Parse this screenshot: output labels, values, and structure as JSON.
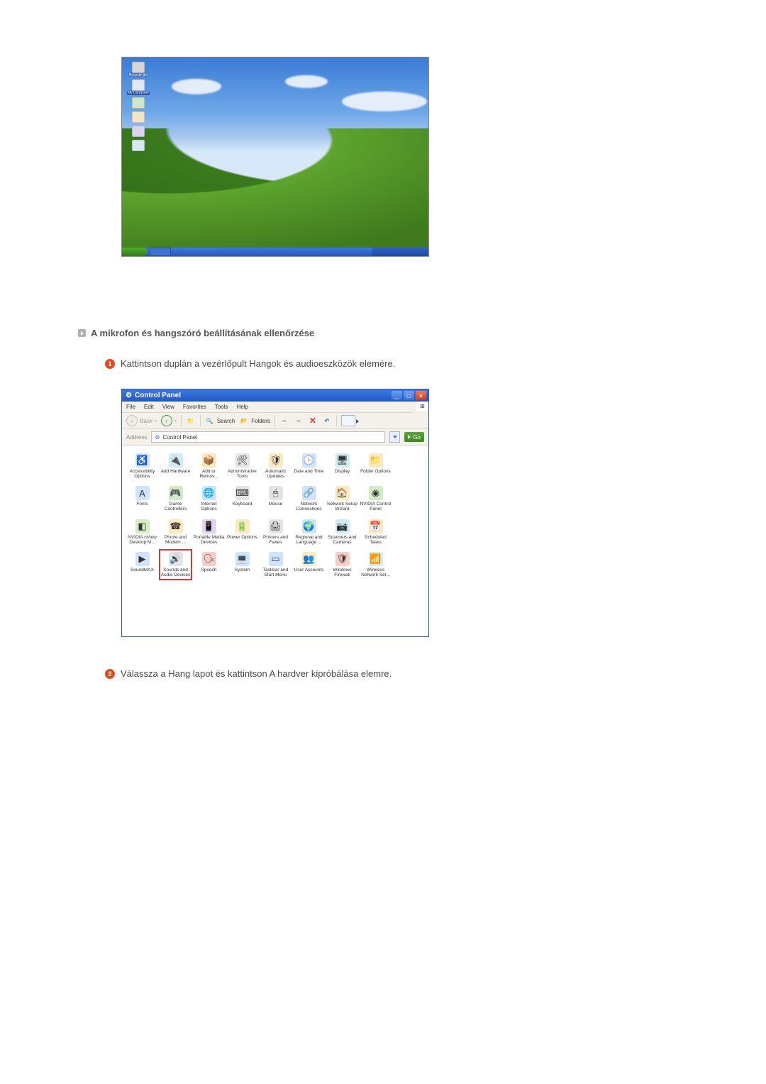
{
  "desktop": {
    "icons": [
      {
        "label": "Recycle Bin"
      },
      {
        "label": "My Computer"
      },
      {
        "label": ""
      },
      {
        "label": ""
      },
      {
        "label": ""
      },
      {
        "label": ""
      }
    ],
    "selected_icon_label": "My Computer"
  },
  "section": {
    "heading": "A mikrofon és hangszóró beállításának ellenőrzése",
    "step1": "Kattintson duplán a vezérlőpult Hangok és audioeszközök elemére.",
    "step2": "Válassza a Hang lapot és kattintson A hardver kipróbálása elemre."
  },
  "control_panel": {
    "title": "Control Panel",
    "menu": {
      "file": "File",
      "edit": "Edit",
      "view": "View",
      "favorites": "Favorites",
      "tools": "Tools",
      "help": "Help"
    },
    "toolbar": {
      "back": "Back",
      "search": "Search",
      "folders": "Folders"
    },
    "address": {
      "label": "Address",
      "value": "Control Panel",
      "go": "Go"
    },
    "items": [
      {
        "label": "Accessibility Options",
        "iconClass": "bg-blue",
        "glyph": "♿"
      },
      {
        "label": "Add Hardware",
        "iconClass": "bg-cyn",
        "glyph": "🔌"
      },
      {
        "label": "Add or Remov...",
        "iconClass": "bg-yel",
        "glyph": "📦"
      },
      {
        "label": "Administrative Tools",
        "iconClass": "bg-gry",
        "glyph": "🛠"
      },
      {
        "label": "Automatic Updates",
        "iconClass": "bg-yel",
        "glyph": "🛡"
      },
      {
        "label": "Date and Time",
        "iconClass": "bg-blue",
        "glyph": "🕒"
      },
      {
        "label": "Display",
        "iconClass": "bg-cyn",
        "glyph": "🖥"
      },
      {
        "label": "Folder Options",
        "iconClass": "bg-yel",
        "glyph": "📁"
      },
      {
        "label": "Fonts",
        "iconClass": "bg-blue",
        "glyph": "A"
      },
      {
        "label": "Game Controllers",
        "iconClass": "bg-grn",
        "glyph": "🎮"
      },
      {
        "label": "Internet Options",
        "iconClass": "bg-blue",
        "glyph": "🌐"
      },
      {
        "label": "Keyboard",
        "iconClass": "bg-gry",
        "glyph": "⌨"
      },
      {
        "label": "Mouse",
        "iconClass": "bg-gry",
        "glyph": "🖱"
      },
      {
        "label": "Network Connections",
        "iconClass": "bg-blue",
        "glyph": "🔗"
      },
      {
        "label": "Network Setup Wizard",
        "iconClass": "bg-yel",
        "glyph": "🏠"
      },
      {
        "label": "NVIDIA Control Panel",
        "iconClass": "bg-grn",
        "glyph": "◉"
      },
      {
        "label": "NVIDIA nView Desktop M...",
        "iconClass": "bg-grn",
        "glyph": "◧"
      },
      {
        "label": "Phone and Modem ...",
        "iconClass": "bg-yel",
        "glyph": "☎"
      },
      {
        "label": "Portable Media Devices",
        "iconClass": "bg-pur",
        "glyph": "📱"
      },
      {
        "label": "Power Options",
        "iconClass": "bg-yel",
        "glyph": "🔋"
      },
      {
        "label": "Printers and Faxes",
        "iconClass": "bg-gry",
        "glyph": "🖨"
      },
      {
        "label": "Regional and Language ...",
        "iconClass": "bg-blue",
        "glyph": "🌍"
      },
      {
        "label": "Scanners and Cameras",
        "iconClass": "bg-cyn",
        "glyph": "📷"
      },
      {
        "label": "Scheduled Tasks",
        "iconClass": "bg-yel",
        "glyph": "📅"
      },
      {
        "label": "SoundMAX",
        "iconClass": "bg-blue",
        "glyph": "▶"
      },
      {
        "label": "Sounds and Audio Devices",
        "iconClass": "bg-gry",
        "glyph": "🔊",
        "highlight": true
      },
      {
        "label": "Speech",
        "iconClass": "bg-red",
        "glyph": "🗣"
      },
      {
        "label": "System",
        "iconClass": "bg-blue",
        "glyph": "💻"
      },
      {
        "label": "Taskbar and Start Menu",
        "iconClass": "bg-blue",
        "glyph": "▭"
      },
      {
        "label": "User Accounts",
        "iconClass": "bg-yel",
        "glyph": "👥"
      },
      {
        "label": "Windows Firewall",
        "iconClass": "bg-red",
        "glyph": "🛡"
      },
      {
        "label": "Wireless Network Set...",
        "iconClass": "bg-cyn",
        "glyph": "📶"
      }
    ]
  }
}
